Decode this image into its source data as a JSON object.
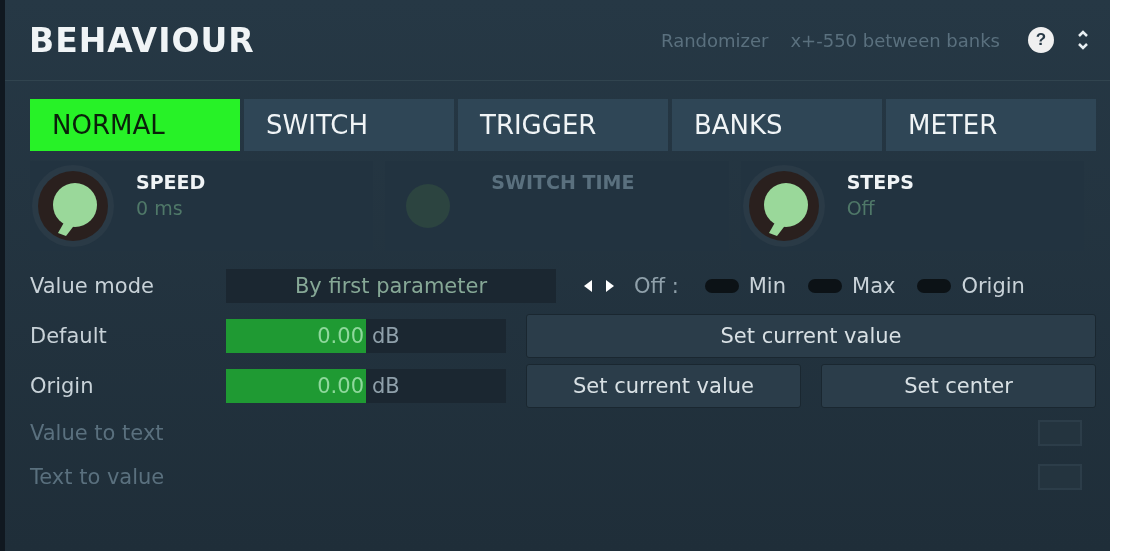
{
  "header": {
    "title": "BEHAVIOUR",
    "hint_1": "Randomizer",
    "hint_2": "x+-550 between banks",
    "help": "?"
  },
  "tabs": [
    {
      "label": "NORMAL",
      "selected": true
    },
    {
      "label": "SWITCH",
      "selected": false
    },
    {
      "label": "TRIGGER",
      "selected": false
    },
    {
      "label": "BANKS",
      "selected": false
    },
    {
      "label": "METER",
      "selected": false
    }
  ],
  "knobs": [
    {
      "label": "SPEED",
      "value": "0 ms",
      "disabled": false
    },
    {
      "label": "SWITCH TIME",
      "disabled": true
    },
    {
      "label": "STEPS",
      "value": "Off",
      "disabled": false
    }
  ],
  "value_mode": {
    "label": "Value mode",
    "value": "By first parameter",
    "off_label": "Off :",
    "toggles": [
      {
        "label": "Min",
        "on": false
      },
      {
        "label": "Max",
        "on": false
      },
      {
        "label": "Origin",
        "on": false
      }
    ]
  },
  "default": {
    "label": "Default",
    "value": "0.00",
    "unit": "dB",
    "level": 0.5,
    "buttons": [
      "Set current value"
    ]
  },
  "origin": {
    "label": "Origin",
    "value": "0.00",
    "unit": "dB",
    "level": 0.5,
    "buttons": [
      "Set current value",
      "Set center"
    ]
  },
  "options": [
    {
      "label": "Value to text",
      "disabled": true,
      "checked": false
    },
    {
      "label": "Text to value",
      "disabled": true,
      "checked": false
    }
  ]
}
